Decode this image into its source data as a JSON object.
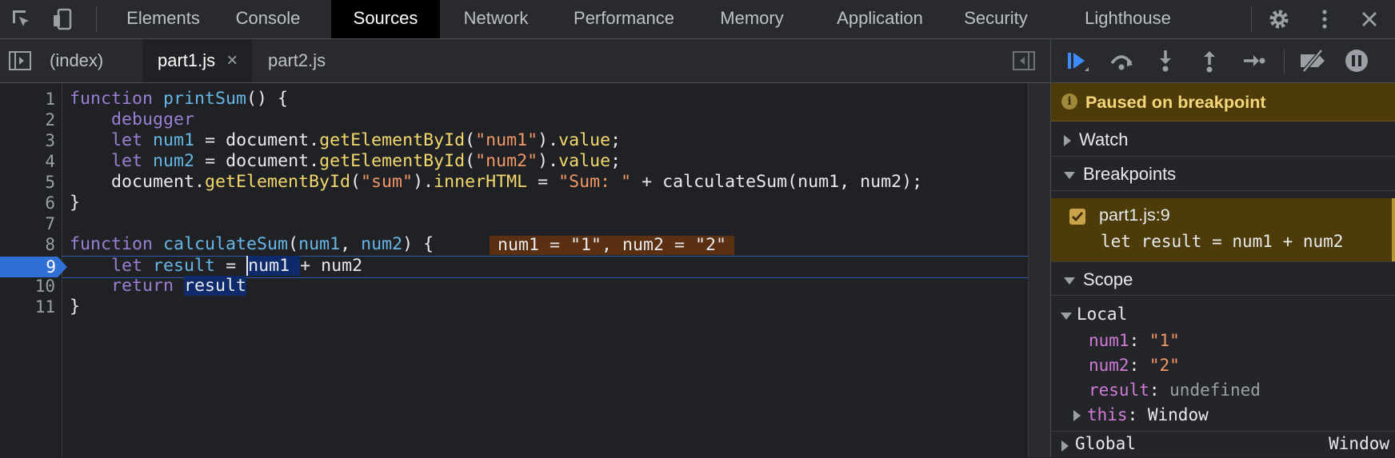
{
  "toolbar": {
    "tabs": [
      {
        "label": "Elements"
      },
      {
        "label": "Console"
      },
      {
        "label": "Sources"
      },
      {
        "label": "Network"
      },
      {
        "label": "Performance"
      },
      {
        "label": "Memory"
      },
      {
        "label": "Application"
      },
      {
        "label": "Security"
      },
      {
        "label": "Lighthouse"
      }
    ],
    "active_tab": "Sources",
    "icons": [
      "inspect-element-icon",
      "device-toolbar-icon",
      "settings-gear-icon",
      "more-vertical-icon",
      "close-icon"
    ]
  },
  "file_tabs": [
    {
      "label": "(index)"
    },
    {
      "label": "part1.js"
    },
    {
      "label": "part2.js"
    }
  ],
  "file_tab_close": "×",
  "editor": {
    "line_numbers": [
      "1",
      "2",
      "3",
      "4",
      "5",
      "6",
      "7",
      "8",
      "9",
      "10",
      "11"
    ],
    "current_line": "9",
    "inline_values": "num1 = \"1\", num2 = \"2\""
  },
  "debugger": {
    "paused_message": "Paused on breakpoint",
    "watch_label": "Watch",
    "breakpoints_label": "Breakpoints",
    "breakpoint": {
      "location": "part1.js:9",
      "code": "let result = num1 + num2",
      "checked": true
    },
    "scope_label": "Scope",
    "local_label": "Local",
    "local_vars": [
      {
        "name": "num1",
        "value": "\"1\""
      },
      {
        "name": "num2",
        "value": "\"2\""
      },
      {
        "name": "result",
        "value": "undefined"
      },
      {
        "name": "this",
        "value": "Window"
      }
    ],
    "global_label": "Global",
    "global_value": "Window"
  },
  "colors": {
    "accent_blue": "#1a73e8",
    "paused_bg": "#4d3b0a",
    "paused_text": "#f4d67a",
    "keyword": "#9a7fd5",
    "function": "#66b7e6",
    "string": "#f29766",
    "property": "#f3d86d"
  }
}
